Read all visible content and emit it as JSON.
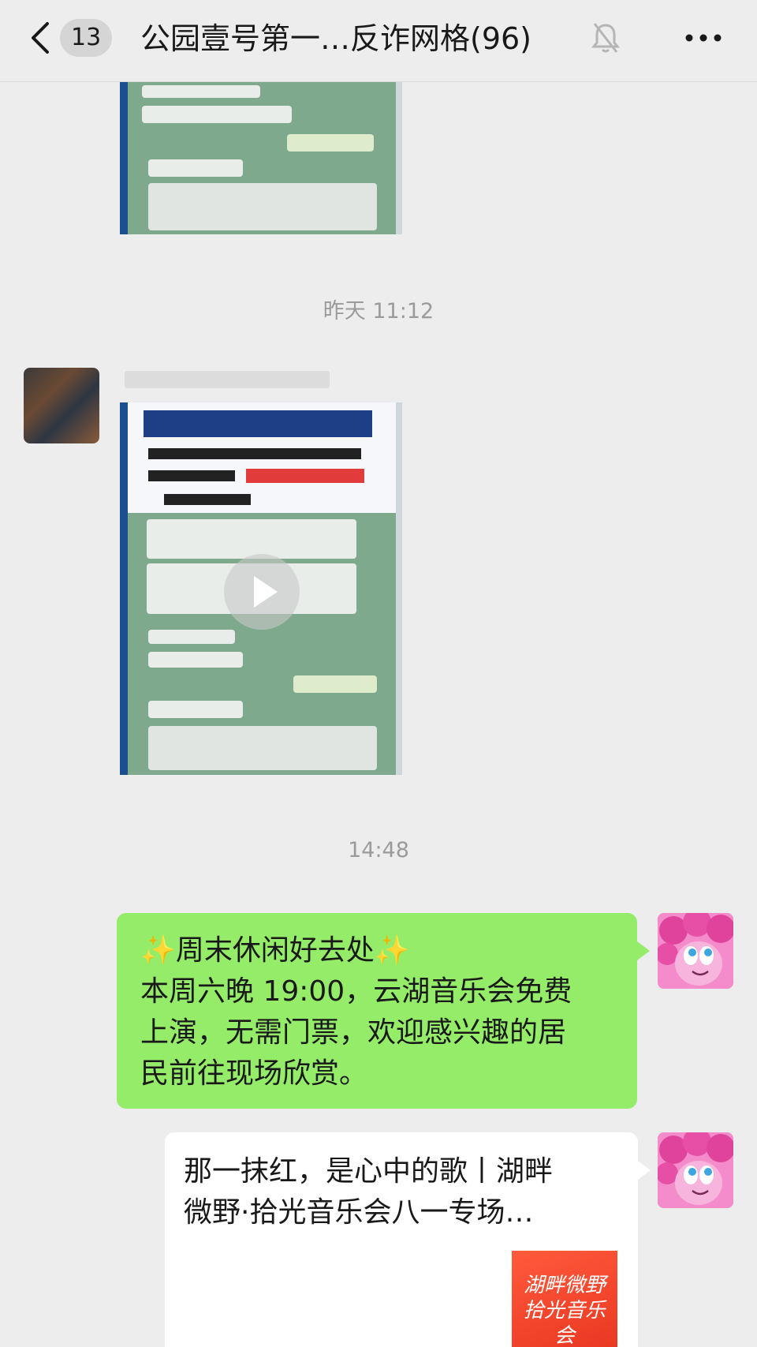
{
  "header": {
    "unread_count": "13",
    "title": "公园壹号第一…反诈网格(96)",
    "mute_icon": "bell-off-icon",
    "more_icon": "more-dots-icon"
  },
  "messages": {
    "time1": "昨天 11:12",
    "time2": "14:48",
    "notice": {
      "line1": "周末休闲好去处",
      "line2": "本周六晚 19:00，云湖音乐会免费",
      "line3": "上演，无需门票，欢迎感兴趣的居",
      "line4": "民前往现场欣赏。"
    },
    "card": {
      "title_line1": "那一抹红，是心中的歌丨湖畔",
      "title_line2": "微野·拾光音乐会八一专场…",
      "thumb_line1": "湖畔微野",
      "thumb_line2": "拾光音乐会"
    }
  },
  "colors": {
    "bubble_green": "#95ec69",
    "background": "#ededed"
  }
}
